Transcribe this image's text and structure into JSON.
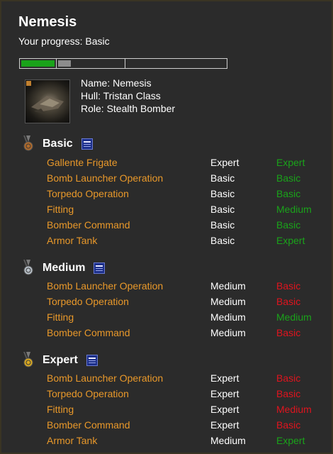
{
  "header": {
    "title": "Nemesis",
    "progress_label": "Your progress: Basic",
    "progress_segments": [
      {
        "level": "Basic",
        "fill_fraction": 1.0,
        "color": "#1aa31a"
      },
      {
        "level": "Medium",
        "fill_fraction": 0.2,
        "color": "#8c8c8c"
      },
      {
        "level": "Expert",
        "fill_fraction": 0.0,
        "color": "#8c8c8c"
      }
    ]
  },
  "ship": {
    "name_line": "Name: Nemesis",
    "hull_line": "Hull: Tristan Class",
    "role_line": "Role: Stealth Bomber"
  },
  "colors": {
    "skill_name": "#e8982a",
    "ok": "#1aa31a",
    "bad": "#e0141e"
  },
  "sections": [
    {
      "title": "Basic",
      "medal": "bronze",
      "skills": [
        {
          "name": "Gallente Frigate",
          "required": "Expert",
          "current": "Expert",
          "status": "ok"
        },
        {
          "name": "Bomb Launcher Operation",
          "required": "Basic",
          "current": "Basic",
          "status": "ok"
        },
        {
          "name": "Torpedo Operation",
          "required": "Basic",
          "current": "Basic",
          "status": "ok"
        },
        {
          "name": "Fitting",
          "required": "Basic",
          "current": "Medium",
          "status": "ok"
        },
        {
          "name": "Bomber Command",
          "required": "Basic",
          "current": "Basic",
          "status": "ok"
        },
        {
          "name": "Armor Tank",
          "required": "Basic",
          "current": "Expert",
          "status": "ok"
        }
      ]
    },
    {
      "title": "Medium",
      "medal": "silver",
      "skills": [
        {
          "name": "Bomb Launcher Operation",
          "required": "Medium",
          "current": "Basic",
          "status": "bad"
        },
        {
          "name": "Torpedo Operation",
          "required": "Medium",
          "current": "Basic",
          "status": "bad"
        },
        {
          "name": "Fitting",
          "required": "Medium",
          "current": "Medium",
          "status": "ok"
        },
        {
          "name": "Bomber Command",
          "required": "Medium",
          "current": "Basic",
          "status": "bad"
        }
      ]
    },
    {
      "title": "Expert",
      "medal": "gold",
      "skills": [
        {
          "name": "Bomb Launcher Operation",
          "required": "Expert",
          "current": "Basic",
          "status": "bad"
        },
        {
          "name": "Torpedo Operation",
          "required": "Expert",
          "current": "Basic",
          "status": "bad"
        },
        {
          "name": "Fitting",
          "required": "Expert",
          "current": "Medium",
          "status": "bad"
        },
        {
          "name": "Bomber Command",
          "required": "Expert",
          "current": "Basic",
          "status": "bad"
        },
        {
          "name": "Armor Tank",
          "required": "Medium",
          "current": "Expert",
          "status": "ok"
        }
      ]
    }
  ]
}
